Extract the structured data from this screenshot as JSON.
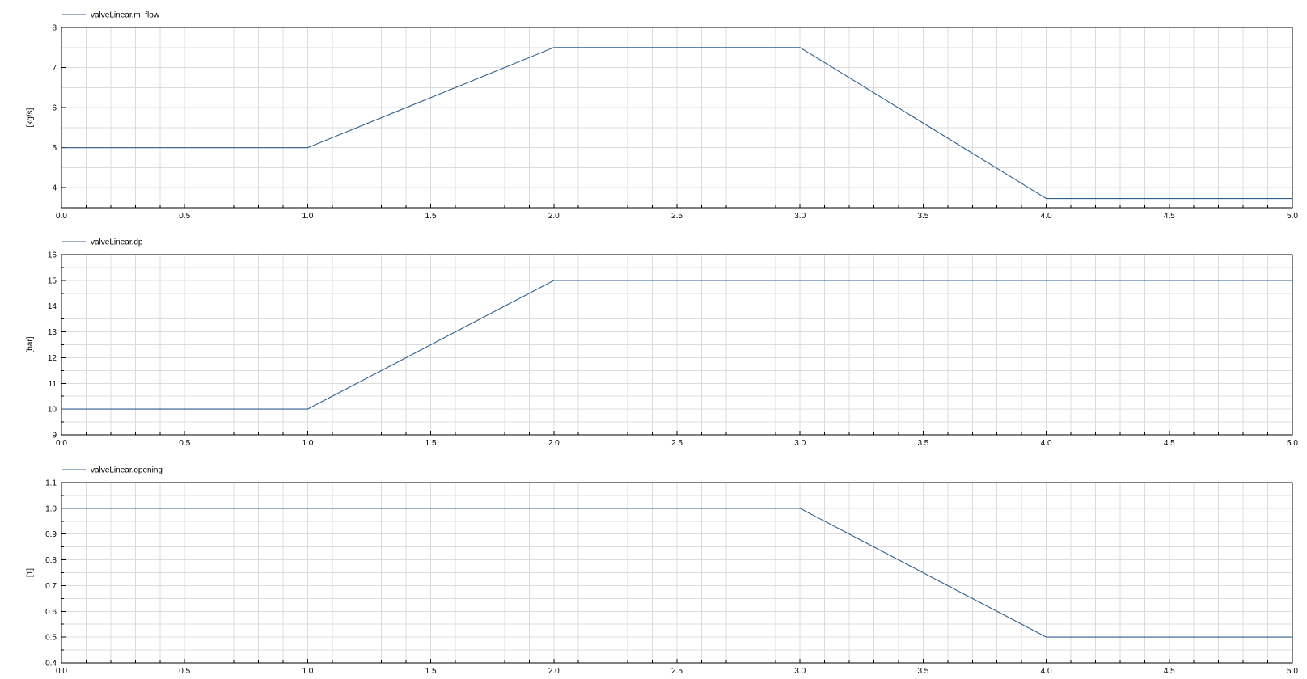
{
  "colors": {
    "series": "#2d5f8e",
    "grid": "#dcdcdc",
    "frame": "#000000",
    "background": "#ffffff"
  },
  "chart_data": [
    {
      "type": "line",
      "legend_position": "top-left",
      "grid": true,
      "ylabel": "[kg/s]",
      "xlim": [
        0,
        5
      ],
      "ylim": [
        3.5,
        8
      ],
      "x_ticks": [
        "0.0",
        "0.5",
        "1.0",
        "1.5",
        "2.0",
        "2.5",
        "3.0",
        "3.5",
        "4.0",
        "4.5",
        "5.0"
      ],
      "y_ticks": [
        {
          "value": 4,
          "label": "4"
        },
        {
          "value": 5,
          "label": "5"
        },
        {
          "value": 6,
          "label": "6"
        },
        {
          "value": 7,
          "label": "7"
        },
        {
          "value": 8,
          "label": "8"
        }
      ],
      "series": [
        {
          "name": "valveLinear.m_flow",
          "x": [
            0,
            1,
            2,
            3,
            4,
            5
          ],
          "y": [
            5,
            5,
            7.5,
            7.5,
            3.73,
            3.73
          ]
        }
      ]
    },
    {
      "type": "line",
      "legend_position": "top-left",
      "grid": true,
      "ylabel": "[bar]",
      "xlim": [
        0,
        5
      ],
      "ylim": [
        9,
        16
      ],
      "x_ticks": [
        "0.0",
        "0.5",
        "1.0",
        "1.5",
        "2.0",
        "2.5",
        "3.0",
        "3.5",
        "4.0",
        "4.5",
        "5.0"
      ],
      "y_ticks": [
        {
          "value": 9,
          "label": "9"
        },
        {
          "value": 10,
          "label": "10"
        },
        {
          "value": 11,
          "label": "11"
        },
        {
          "value": 12,
          "label": "12"
        },
        {
          "value": 13,
          "label": "13"
        },
        {
          "value": 14,
          "label": "14"
        },
        {
          "value": 15,
          "label": "15"
        },
        {
          "value": 16,
          "label": "16"
        }
      ],
      "series": [
        {
          "name": "valveLinear.dp",
          "x": [
            0,
            1,
            2,
            5
          ],
          "y": [
            10,
            10,
            15,
            15
          ]
        }
      ]
    },
    {
      "type": "line",
      "legend_position": "top-left",
      "grid": true,
      "ylabel": "[1]",
      "xlim": [
        0,
        5
      ],
      "ylim": [
        0.4,
        1.1
      ],
      "x_ticks": [
        "0.0",
        "0.5",
        "1.0",
        "1.5",
        "2.0",
        "2.5",
        "3.0",
        "3.5",
        "4.0",
        "4.5",
        "5.0"
      ],
      "y_ticks": [
        {
          "value": 0.4,
          "label": "0.4"
        },
        {
          "value": 0.5,
          "label": "0.5"
        },
        {
          "value": 0.6,
          "label": "0.6"
        },
        {
          "value": 0.7,
          "label": "0.7"
        },
        {
          "value": 0.8,
          "label": "0.8"
        },
        {
          "value": 0.9,
          "label": "0.9"
        },
        {
          "value": 1.0,
          "label": "1.0"
        },
        {
          "value": 1.1,
          "label": "1.1"
        }
      ],
      "series": [
        {
          "name": "valveLinear.opening",
          "x": [
            0,
            3,
            4,
            5
          ],
          "y": [
            1.0,
            1.0,
            0.5,
            0.5
          ]
        }
      ]
    }
  ]
}
